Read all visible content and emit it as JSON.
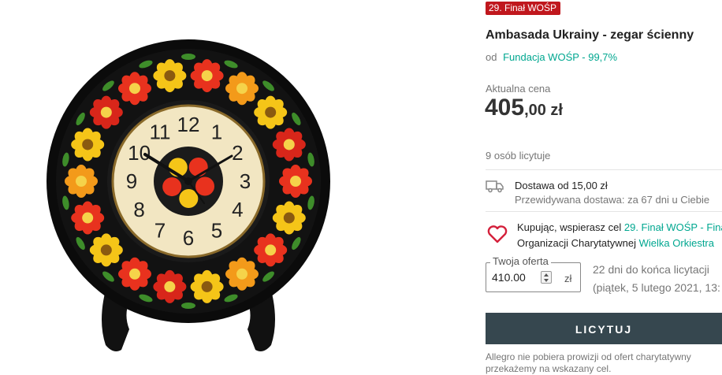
{
  "badge": "29. Finał WOŚP",
  "product": {
    "title": "Ambasada Ukrainy - zegar ścienny",
    "seller_prefix": "od",
    "seller_name": "Fundacja WOŚP - 99,7%",
    "image_icon": "wall-clock-painted-plate-image"
  },
  "price": {
    "label": "Aktualna cena",
    "whole": "405",
    "decimal": ",00 zł"
  },
  "bidders": "9 osób licytuje",
  "delivery": {
    "icon": "truck-icon",
    "main": "Dostawa od 15,00 zł",
    "estimate": "Przewidywana dostawa: za 67 dni u Ciebie"
  },
  "charity": {
    "icon": "heart-icon",
    "line1_prefix": "Kupując, wspierasz cel",
    "line1_link": "29. Finał WOŚP - Fina",
    "line2_prefix": "Organizacji Charytatywnej",
    "line2_link": "Wielka Orkiestra"
  },
  "offer": {
    "legend": "Twoja oferta",
    "value": "410.00",
    "currency": "zł",
    "time_left": "22 dni do końca licytacji",
    "end_date": "(piątek, 5 lutego 2021, 13:"
  },
  "bid_button": "LICYTUJ",
  "footnote": {
    "line1": "Allegro nie pobiera prowizji od ofert charytatywny",
    "line2": "przekażemy na wskazany cel."
  },
  "clock_numbers": [
    "12",
    "1",
    "2",
    "3",
    "4",
    "5",
    "6",
    "7",
    "8",
    "9",
    "10",
    "11"
  ],
  "colors": {
    "badge_bg": "#c0171d",
    "link": "#00a790",
    "button_bg": "#36474f",
    "heart": "#d4203b"
  }
}
